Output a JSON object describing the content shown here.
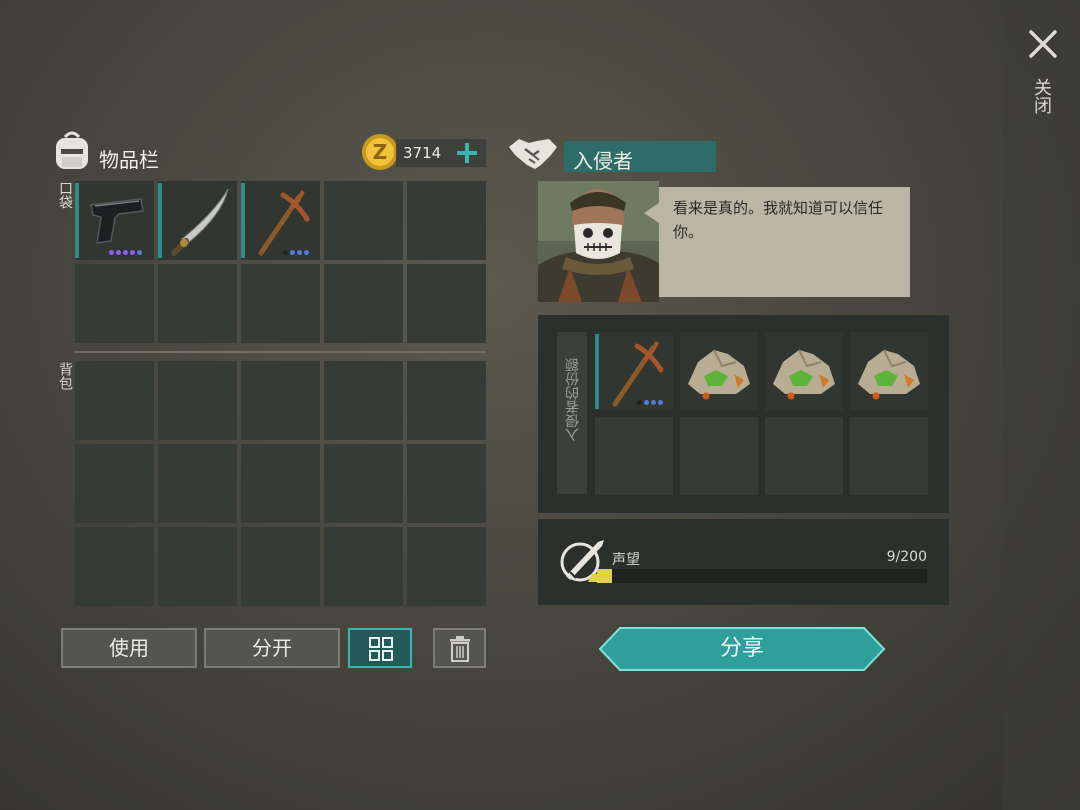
{
  "close": {
    "label": "关闭"
  },
  "inventory": {
    "title": "物品栏",
    "currency": {
      "amount": "3714"
    },
    "pocket_label": "口袋",
    "backpack_label": "背包",
    "pocket_items": [
      {
        "icon": "pistol-icon",
        "dots": [
          "#8b5cf6",
          "#8b5cf6",
          "#8b5cf6",
          "#8b5cf6",
          "#4f7ad6"
        ]
      },
      {
        "icon": "machete-icon",
        "dots": []
      },
      {
        "icon": "pickaxe-icon",
        "dots": [
          "#222",
          "#4f7ad6",
          "#4f7ad6",
          "#4f7ad6"
        ]
      }
    ]
  },
  "actions": {
    "use_label": "使用",
    "split_label": "分开",
    "grid_icon": "grid-view-icon",
    "trash_icon": "trash-icon"
  },
  "invader": {
    "title": "入侵者",
    "speech": "看来是真的。我就知道可以信任你。",
    "share_label": "入侵者的份额",
    "share_items": [
      {
        "icon": "pickaxe-icon"
      },
      {
        "icon": "ore-pile-icon"
      },
      {
        "icon": "ore-pile-icon"
      },
      {
        "icon": "ore-pile-icon"
      }
    ]
  },
  "reputation": {
    "label": "声望",
    "value_text": "9/200",
    "current": 9,
    "max": 200,
    "fill_color": "#e2d24a"
  },
  "share_button": {
    "label": "分享",
    "color": "#2e9f9b"
  }
}
